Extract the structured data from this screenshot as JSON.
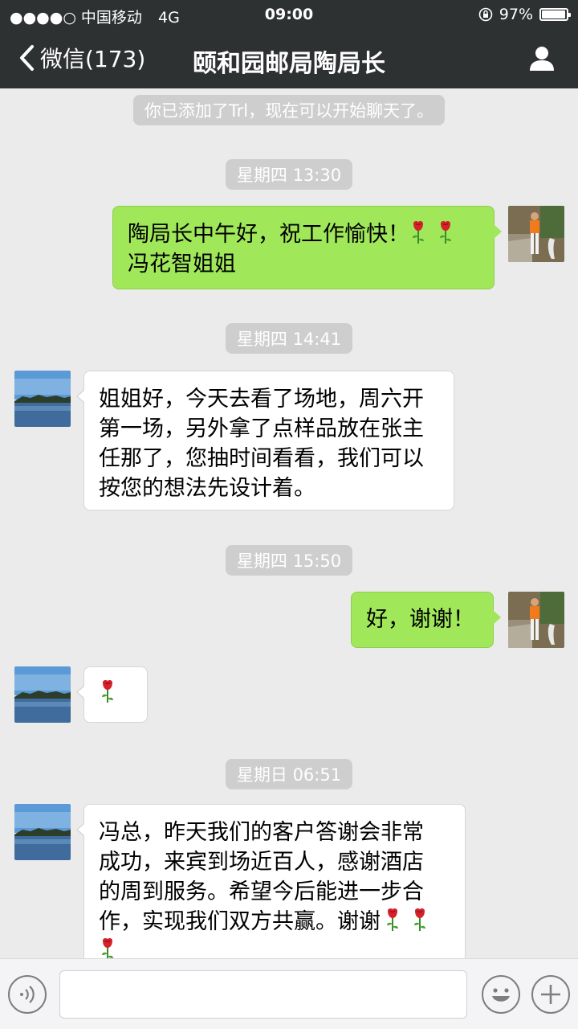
{
  "status_bar": {
    "carrier": "●●●●○ 中国移动",
    "network": "4G",
    "time": "09:00",
    "battery": "97%",
    "battery_level": 0.97
  },
  "nav": {
    "back_label": "微信(173)",
    "title": "颐和园邮局陶局长"
  },
  "chat": {
    "system_notice": "你已添加了Trl，现在可以开始聊天了。",
    "timestamps": [
      "星期四 13:30",
      "星期四 14:41",
      "星期四 15:50",
      "星期日 06:51"
    ],
    "messages": [
      {
        "from": "me",
        "line1": "陶局长中午好，祝工作愉快！",
        "line2": "冯花智姐姐",
        "emoji": "rose x2"
      },
      {
        "from": "other",
        "lines": [
          "姐姐好，今天去看了场地，周六开",
          "第一场，另外拿了点样品放在张主",
          "任那了，您抽时间看看，我们可以",
          "按您的想法先设计着。"
        ]
      },
      {
        "from": "me",
        "text": "好，谢谢！"
      },
      {
        "from": "other",
        "emoji": "rose"
      },
      {
        "from": "other",
        "lines": [
          "冯总，昨天我们的客户答谢会非常",
          "成功，来宾到场近百人，感谢酒店",
          "的周到服务。希望今后能进一步合",
          "作，实现我们双方共赢。谢谢"
        ],
        "emoji": "rose x3"
      }
    ]
  },
  "input": {
    "placeholder": ""
  },
  "colors": {
    "nav_bg": "#2e3132",
    "chat_bg": "#ebebeb",
    "out_bubble": "#a0e75a",
    "in_bubble": "#ffffff"
  }
}
